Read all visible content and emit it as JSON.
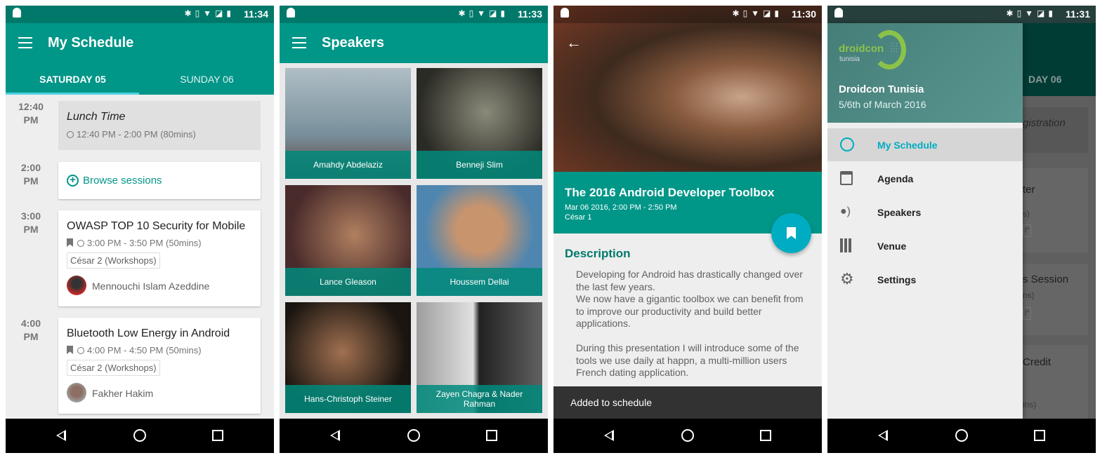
{
  "colors": {
    "primary": "#009688",
    "primary_dark": "#00796b",
    "accent": "#00acc1",
    "drawer_header": "#4e8a84"
  },
  "screens": {
    "schedule": {
      "status_time": "11:34",
      "title": "My Schedule",
      "tabs": [
        "SATURDAY 05",
        "SUNDAY 06"
      ],
      "selected_tab": 0,
      "slots": [
        {
          "time": "12:40",
          "ampm": "PM",
          "title": "Lunch Time",
          "meta": "12:40 PM - 2:00 PM (80mins)"
        },
        {
          "time": "2:00",
          "ampm": "PM",
          "action": "Browse sessions"
        },
        {
          "time": "3:00",
          "ampm": "PM",
          "title": "OWASP TOP 10 Security for Mobile",
          "meta": "3:00 PM - 3:50 PM (50mins)",
          "room": "César 2 (Workshops)",
          "speaker": "Mennouchi Islam Azeddine"
        },
        {
          "time": "4:00",
          "ampm": "PM",
          "title": "Bluetooth Low Energy in Android",
          "meta": "4:00 PM - 4:50 PM (50mins)",
          "room": "César 2 (Workshops)",
          "speaker": "Fakher Hakim"
        }
      ]
    },
    "speakers": {
      "status_time": "11:33",
      "title": "Speakers",
      "items": [
        "Amahdy Abdelaziz",
        "Benneji Slim",
        "Lance Gleason",
        "Houssem Dellai",
        "Hans-Christoph Steiner",
        "Zayen Chagra & Nader Rahman"
      ]
    },
    "session": {
      "status_time": "11:30",
      "title": "The 2016 Android Developer Toolbox",
      "datetime": "Mar 06 2016, 2:00 PM - 2:50 PM",
      "room": "César 1",
      "description_heading": "Description",
      "description_p1": "Developing for Android has drastically changed over the last few years.\nWe now have a gigantic toolbox we can benefit from to improve our productivity and build better applications.",
      "description_p2": "During this presentation I will introduce some of the tools we use daily at happn, a multi-million users French dating application.",
      "snackbar": "Added to schedule"
    },
    "drawer": {
      "status_time": "11:31",
      "logo_text": "droidcon",
      "logo_sub": "tunisia",
      "event_name": "Droidcon Tunisia",
      "event_dates": "5/6th of March 2016",
      "items": [
        {
          "label": "My Schedule",
          "icon": "clock-icon",
          "selected": true
        },
        {
          "label": "Agenda",
          "icon": "calendar-icon"
        },
        {
          "label": "Speakers",
          "icon": "speaker-icon"
        },
        {
          "label": "Venue",
          "icon": "building-icon"
        },
        {
          "label": "Settings",
          "icon": "gear-icon"
        }
      ],
      "background_fragments": [
        "DAY 06",
        "gistration",
        "ter",
        "s)",
        "l\"",
        "s Session",
        "ns)",
        "l\"",
        "Credit",
        "ins)"
      ]
    }
  }
}
